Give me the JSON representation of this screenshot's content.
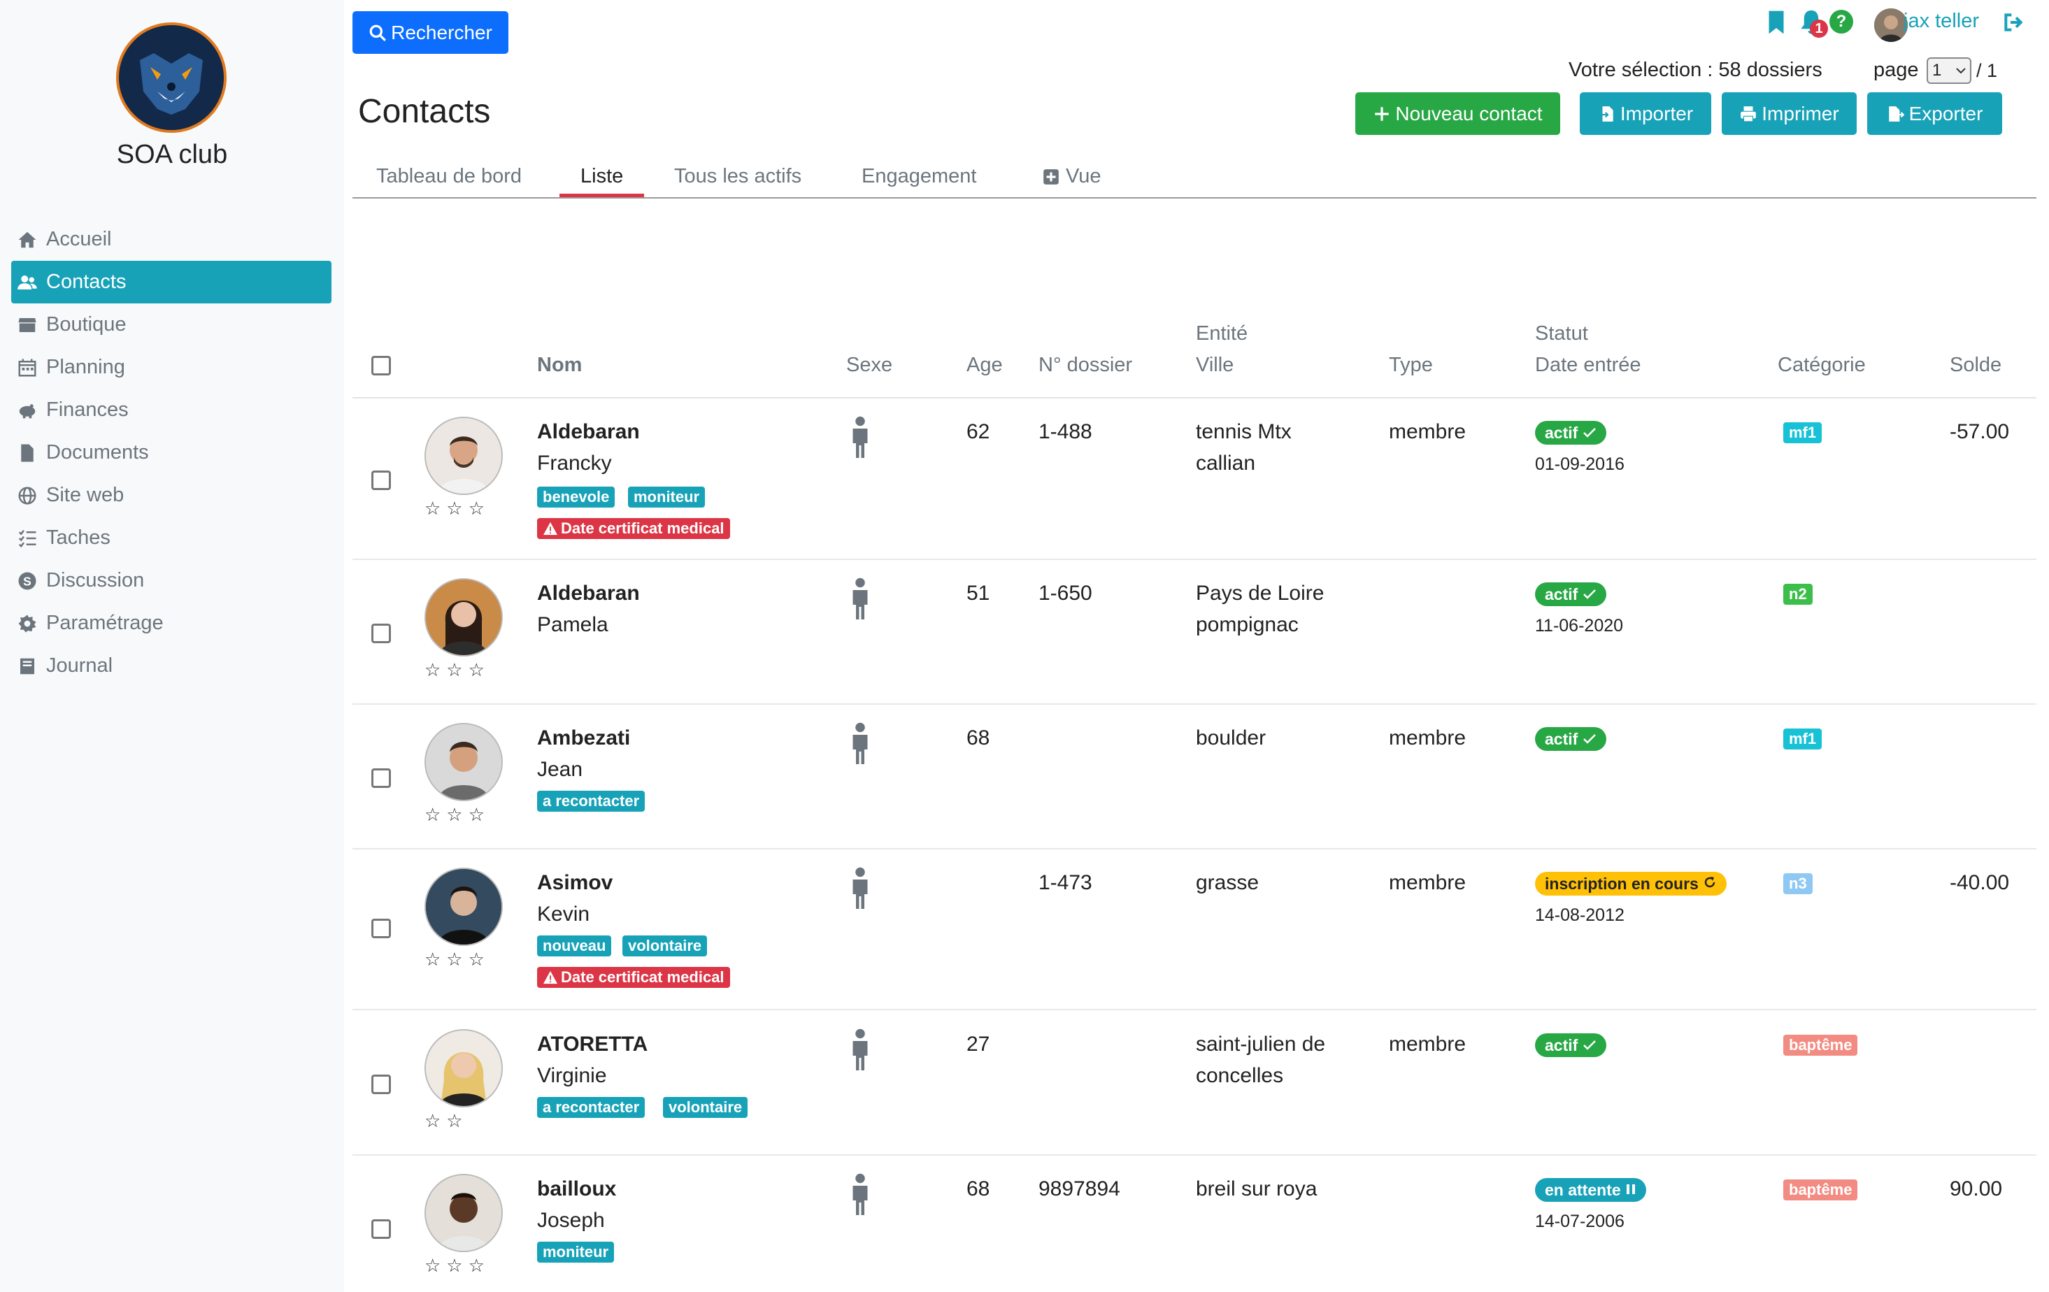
{
  "sidebar": {
    "club_name": "SOA club",
    "items": [
      {
        "label": "Accueil",
        "icon": "home-icon"
      },
      {
        "label": "Contacts",
        "icon": "users-icon",
        "active": true
      },
      {
        "label": "Boutique",
        "icon": "store-icon"
      },
      {
        "label": "Planning",
        "icon": "calendar-icon"
      },
      {
        "label": "Finances",
        "icon": "piggy-bank-icon"
      },
      {
        "label": "Documents",
        "icon": "file-icon"
      },
      {
        "label": "Site web",
        "icon": "globe-icon"
      },
      {
        "label": "Taches",
        "icon": "tasks-icon"
      },
      {
        "label": "Discussion",
        "icon": "chat-icon"
      },
      {
        "label": "Paramétrage",
        "icon": "gear-icon"
      },
      {
        "label": "Journal",
        "icon": "book-icon"
      }
    ]
  },
  "header": {
    "search_label": "Rechercher",
    "title": "Contacts",
    "selection": "Votre sélection : 58 dossiers",
    "page_label": "page",
    "page_value": "1",
    "page_total": "/ 1",
    "user_name": "jax teller",
    "notif_count": "1",
    "buttons": {
      "new_contact": "Nouveau contact",
      "import": "Importer",
      "print": "Imprimer",
      "export": "Exporter"
    }
  },
  "tabs": [
    {
      "label": "Tableau de bord"
    },
    {
      "label": "Liste",
      "active": true
    },
    {
      "label": "Tous les actifs"
    },
    {
      "label": "Engagement"
    },
    {
      "label": "Vue"
    }
  ],
  "table": {
    "headers": {
      "nom": "Nom",
      "sexe": "Sexe",
      "age": "Age",
      "dossier": "N° dossier",
      "entite": "Entité",
      "ville": "Ville",
      "type": "Type",
      "statut": "Statut",
      "date_entree": "Date entrée",
      "categorie": "Catégorie",
      "solde": "Solde"
    },
    "rows": [
      {
        "last": "Aldebaran",
        "first": "Francky",
        "tags": [
          "benevole",
          "moniteur"
        ],
        "alert": "Date certificat medical",
        "age": "62",
        "dossier": "1-488",
        "entite": "tennis Mtx",
        "ville": "callian",
        "type": "membre",
        "status": "actif",
        "status_kind": "green",
        "date": "01-09-2016",
        "cat": "mf1",
        "cat_color": "#17c1d6",
        "solde": "-57.00",
        "stars": "☆☆☆"
      },
      {
        "last": "Aldebaran",
        "first": "Pamela",
        "tags": [],
        "alert": "",
        "age": "51",
        "dossier": "1-650",
        "entite": "Pays de Loire",
        "ville": "pompignac",
        "type": "",
        "status": "actif",
        "status_kind": "green",
        "date": "11-06-2020",
        "cat": "n2",
        "cat_color": "#3cbf4a",
        "solde": "",
        "stars": "☆☆☆"
      },
      {
        "last": "Ambezati",
        "first": "Jean",
        "tags": [
          "a recontacter"
        ],
        "alert": "",
        "age": "68",
        "dossier": "",
        "entite": "boulder",
        "ville": "",
        "type": "membre",
        "status": "actif",
        "status_kind": "green",
        "date": "",
        "cat": "mf1",
        "cat_color": "#17c1d6",
        "solde": "",
        "stars": "☆☆☆"
      },
      {
        "last": "Asimov",
        "first": "Kevin",
        "tags": [
          "nouveau",
          "volontaire"
        ],
        "alert": "Date certificat medical",
        "age": "",
        "dossier": "1-473",
        "entite": "grasse",
        "ville": "",
        "type": "membre",
        "status": "inscription en cours",
        "status_kind": "yellow",
        "date": "14-08-2012",
        "cat": "n3",
        "cat_color": "#8fc8f2",
        "solde": "-40.00",
        "stars": "☆☆☆"
      },
      {
        "last": "ATORETTA",
        "first": "Virginie",
        "tags": [
          "a recontacter",
          "volontaire"
        ],
        "alert": "",
        "age": "27",
        "dossier": "",
        "entite": "saint-julien de",
        "ville": "concelles",
        "type": "membre",
        "status": "actif",
        "status_kind": "green",
        "date": "",
        "cat": "baptême",
        "cat_color": "#f28b82",
        "solde": "",
        "stars": "☆☆"
      },
      {
        "last": "bailloux",
        "first": "Joseph",
        "tags": [
          "moniteur"
        ],
        "alert": "",
        "age": "68",
        "dossier": "9897894",
        "entite": "breil sur roya",
        "ville": "",
        "type": "",
        "status": "en attente",
        "status_kind": "teal",
        "date": "14-07-2006",
        "cat": "baptême",
        "cat_color": "#f28b82",
        "solde": "90.00",
        "stars": "☆☆☆"
      }
    ]
  }
}
